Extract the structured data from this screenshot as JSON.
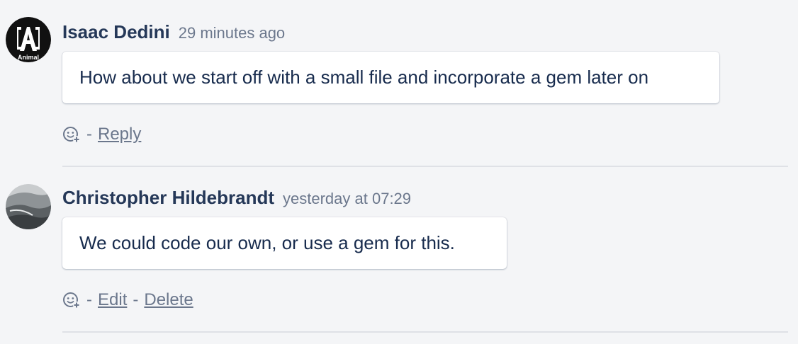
{
  "comments": [
    {
      "author": "Isaac Dedini",
      "time": "29 minutes ago",
      "body": "How about we start off with a small file and incorporate a gem later on",
      "avatar_text": "Animal",
      "actions": {
        "sep": "-",
        "reply": "Reply"
      }
    },
    {
      "author": "Christopher Hildebrandt",
      "time": "yesterday at 07:29",
      "body": "We could code our own, or use a gem for this.",
      "actions": {
        "sep1": "-",
        "edit": "Edit",
        "sep2": "-",
        "delete": "Delete"
      }
    }
  ],
  "colors": {
    "background": "#f4f5f7",
    "author": "#253858",
    "muted": "#6b778c",
    "divider": "#dfe1e6"
  }
}
